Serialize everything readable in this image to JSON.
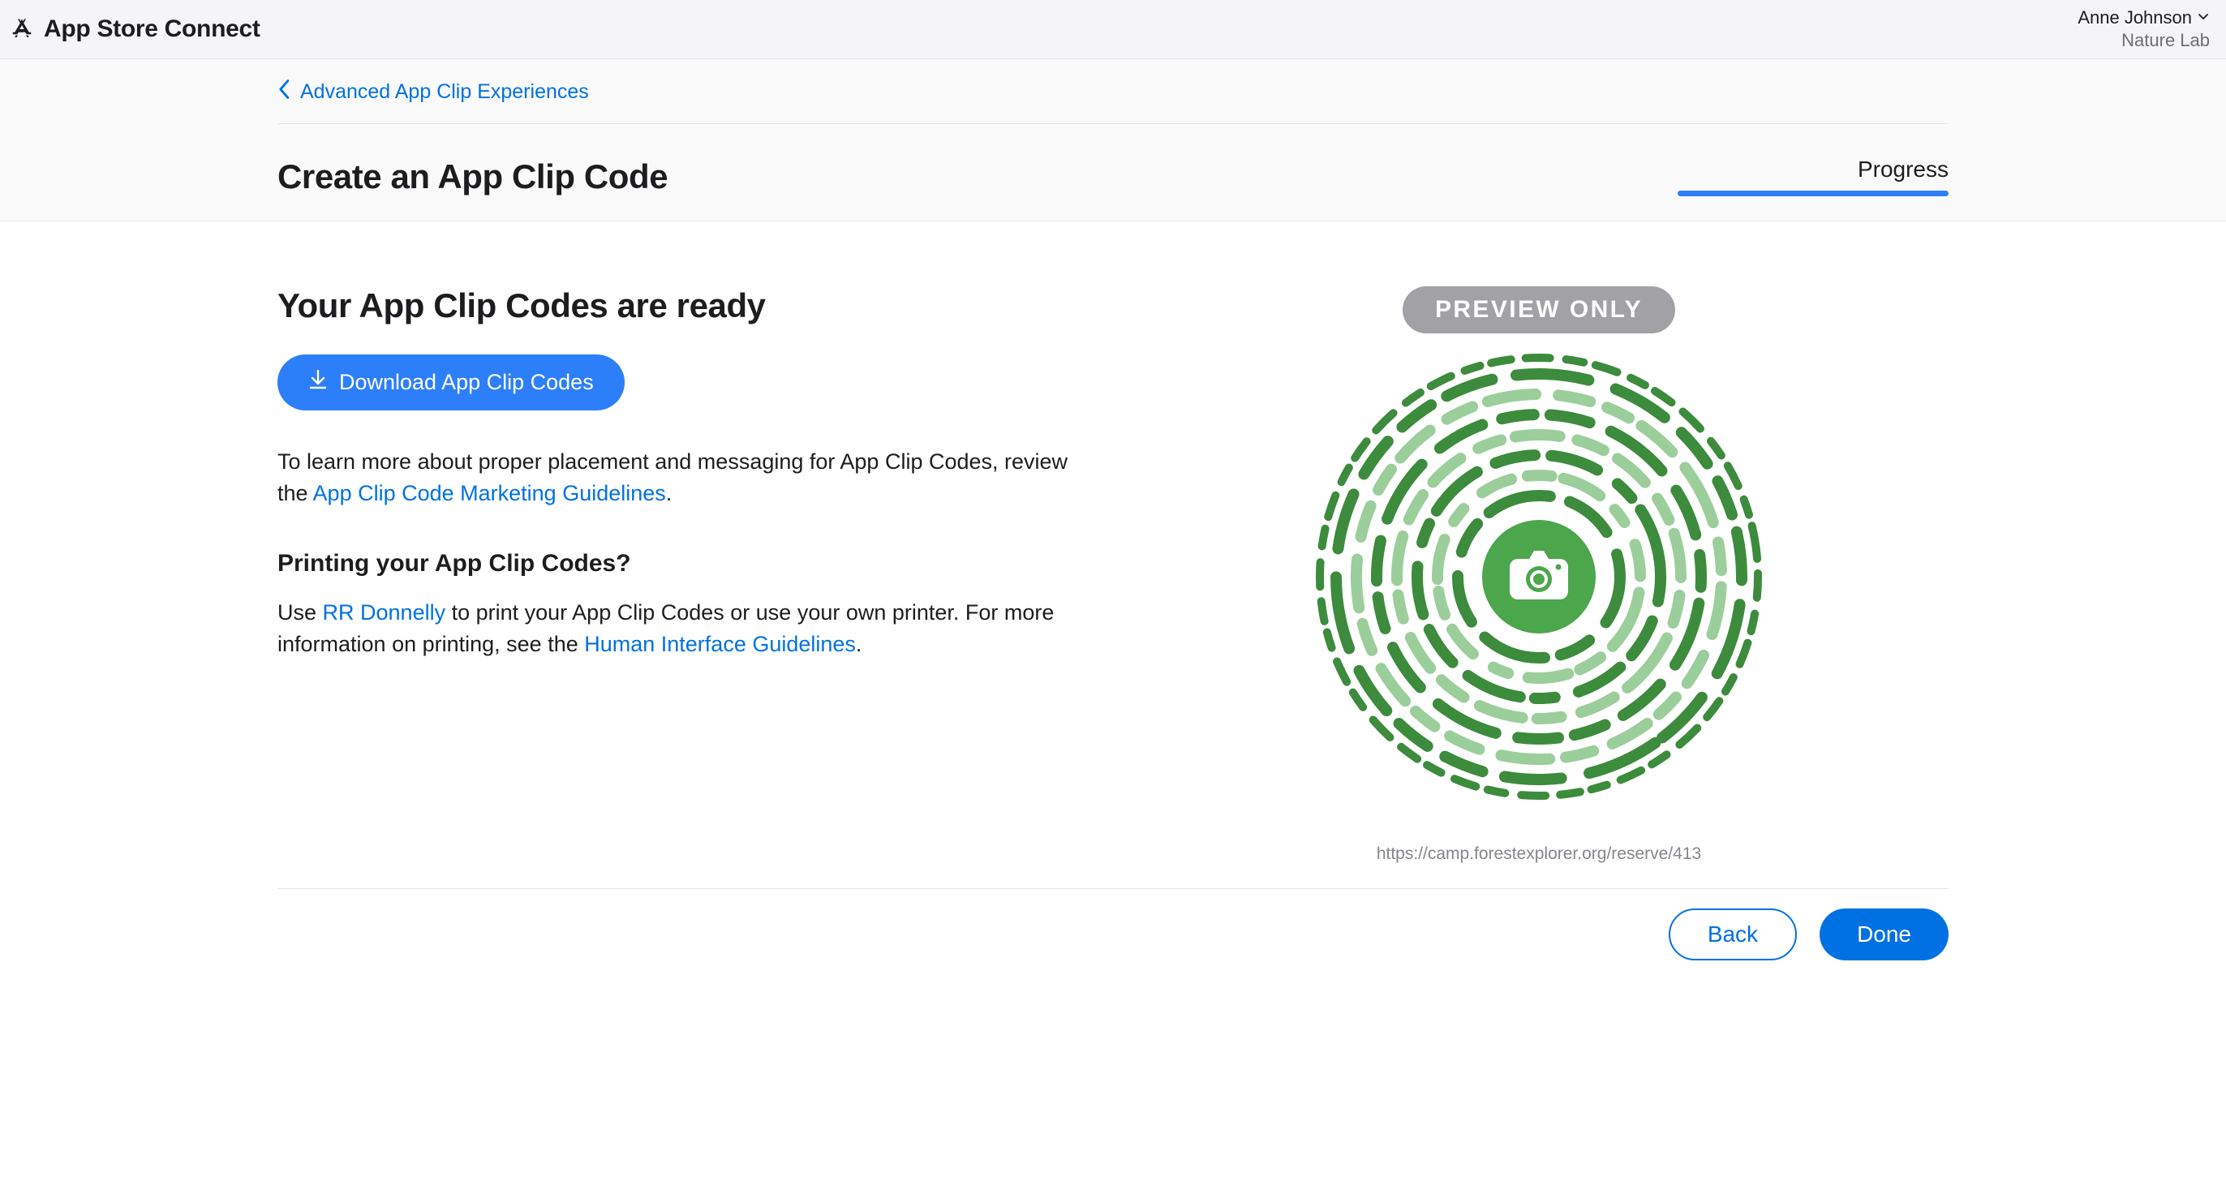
{
  "topbar": {
    "title": "App Store Connect",
    "user_name": "Anne Johnson",
    "org_name": "Nature Lab"
  },
  "breadcrumb": {
    "label": "Advanced App Clip Experiences"
  },
  "header": {
    "page_title": "Create an App Clip Code",
    "progress_label": "Progress"
  },
  "main": {
    "heading": "Your App Clip Codes are ready",
    "download_label": "Download App Clip Codes",
    "learn_text_before": "To learn more about proper placement and messaging for App Clip Codes, review the ",
    "learn_link": "App Clip Code Marketing Guidelines",
    "learn_text_after": ".",
    "print_heading": "Printing your App Clip Codes?",
    "print_before": "Use ",
    "print_link1": "RR Donnelly",
    "print_mid": " to print your App Clip Codes or use your own printer. For more information on printing, see the ",
    "print_link2": "Human Interface Guidelines",
    "print_after": "."
  },
  "preview": {
    "badge": "PREVIEW ONLY",
    "url": "https://camp.forestexplorer.org/reserve/413"
  },
  "footer": {
    "back_label": "Back",
    "done_label": "Done"
  },
  "colors": {
    "accent": "#0071e3",
    "code_dark": "#3d8b3d",
    "code_light": "#9cce9c"
  }
}
